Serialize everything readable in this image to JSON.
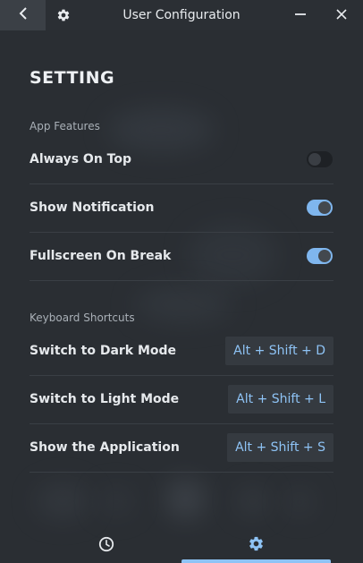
{
  "window": {
    "title": "User Configuration",
    "icons": {
      "back": "back-arrow-icon",
      "app": "gear-icon",
      "minimize": "minimize-icon",
      "close": "close-icon"
    }
  },
  "settings": {
    "heading": "SETTING",
    "app_features": {
      "label": "App Features",
      "items": [
        {
          "label": "Always On Top",
          "enabled": false
        },
        {
          "label": "Show Notification",
          "enabled": true
        },
        {
          "label": "Fullscreen On Break",
          "enabled": true
        }
      ]
    },
    "keyboard_shortcuts": {
      "label": "Keyboard Shortcuts",
      "items": [
        {
          "label": "Switch to Dark Mode",
          "shortcut": "Alt + Shift + D"
        },
        {
          "label": "Switch to Light Mode",
          "shortcut": "Alt + Shift + L"
        },
        {
          "label": "Show the Application",
          "shortcut": "Alt + Shift + S"
        }
      ]
    }
  },
  "bottom_nav": {
    "items": [
      {
        "icon": "clock-icon",
        "active": false
      },
      {
        "icon": "gear-icon",
        "active": true
      }
    ]
  },
  "colors": {
    "background": "#2a2e33",
    "accent": "#8ec3f5",
    "toggle_on": "#7fb6ee",
    "toggle_off": "#1e2125"
  }
}
